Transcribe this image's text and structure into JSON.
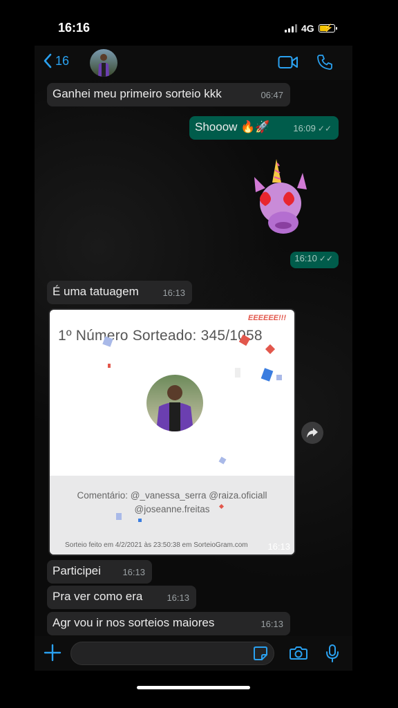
{
  "status_bar": {
    "time": "16:16",
    "network": "4G"
  },
  "header": {
    "back_count": "16"
  },
  "messages": [
    {
      "text": "Ganhei meu primeiro sorteio kkk",
      "time": "06:47"
    },
    {
      "text": "Shooow 🔥🚀",
      "time": "16:09"
    },
    {
      "time": "16:10"
    },
    {
      "text": "É uma tatuagem",
      "time": "16:13"
    },
    {
      "time": "16:13"
    },
    {
      "text": "Participei",
      "time": "16:13"
    },
    {
      "text": "Pra ver como era",
      "time": "16:13"
    },
    {
      "text": "Agr vou ir nos sorteios maiores",
      "time": "16:13"
    }
  ],
  "image": {
    "title": "1º Número Sorteado: 345/1058",
    "shoutout": "EEEEEE!!!",
    "comment_line1": "Comentário: @_vanessa_serra @raiza.oficiall",
    "comment_line2": "@joseanne.freitas",
    "footer": "Sorteio feito em 4/2/2021 às 23:50:38 em SorteioGram.com"
  },
  "colors": {
    "accent": "#2aa1f0",
    "outgoing": "#005c4b",
    "incoming": "#262627"
  },
  "icons": [
    "back-chevron-icon",
    "video-icon",
    "phone-icon",
    "forward-icon",
    "plus-icon",
    "sticker-icon",
    "camera-icon",
    "mic-icon"
  ]
}
